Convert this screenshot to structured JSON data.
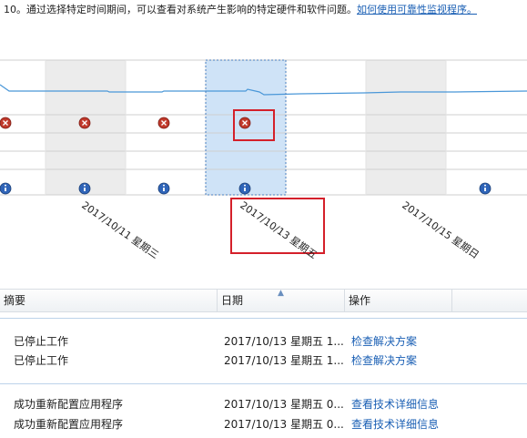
{
  "intro": {
    "text": "10。通过选择特定时间期间，可以查看对系统产生影响的特定硬件和软件问题。",
    "link": "如何使用可靠性监视程序。"
  },
  "timeline": {
    "date_labels": [
      "2017/10/11 星期三",
      "2017/10/13 星期五",
      "2017/10/15 星期日"
    ],
    "colors": {
      "shaded_column": "#ececec",
      "selected_column": "#cfe3f7",
      "selected_border": "#4a7fbf",
      "stability_line": "#4a97d8",
      "highlight_box": "#d4202a",
      "error_icon": "#c0392b",
      "info_icon": "#2f64b8"
    },
    "icons": {
      "error": "error-icon",
      "info": "info-icon"
    }
  },
  "table": {
    "headers": {
      "summary": "摘要",
      "date": "日期",
      "action": "操作"
    },
    "rows": [
      {
        "summary": "已停止工作",
        "date": "2017/10/13 星期五 1...",
        "action": "检查解决方案"
      },
      {
        "summary": "已停止工作",
        "date": "2017/10/13 星期五 1...",
        "action": "检查解决方案"
      },
      {
        "summary": "成功重新配置应用程序",
        "date": "2017/10/13 星期五 0...",
        "action": "查看技术详细信息"
      },
      {
        "summary": "成功重新配置应用程序",
        "date": "2017/10/13 星期五 0...",
        "action": "查看技术详细信息"
      }
    ]
  }
}
